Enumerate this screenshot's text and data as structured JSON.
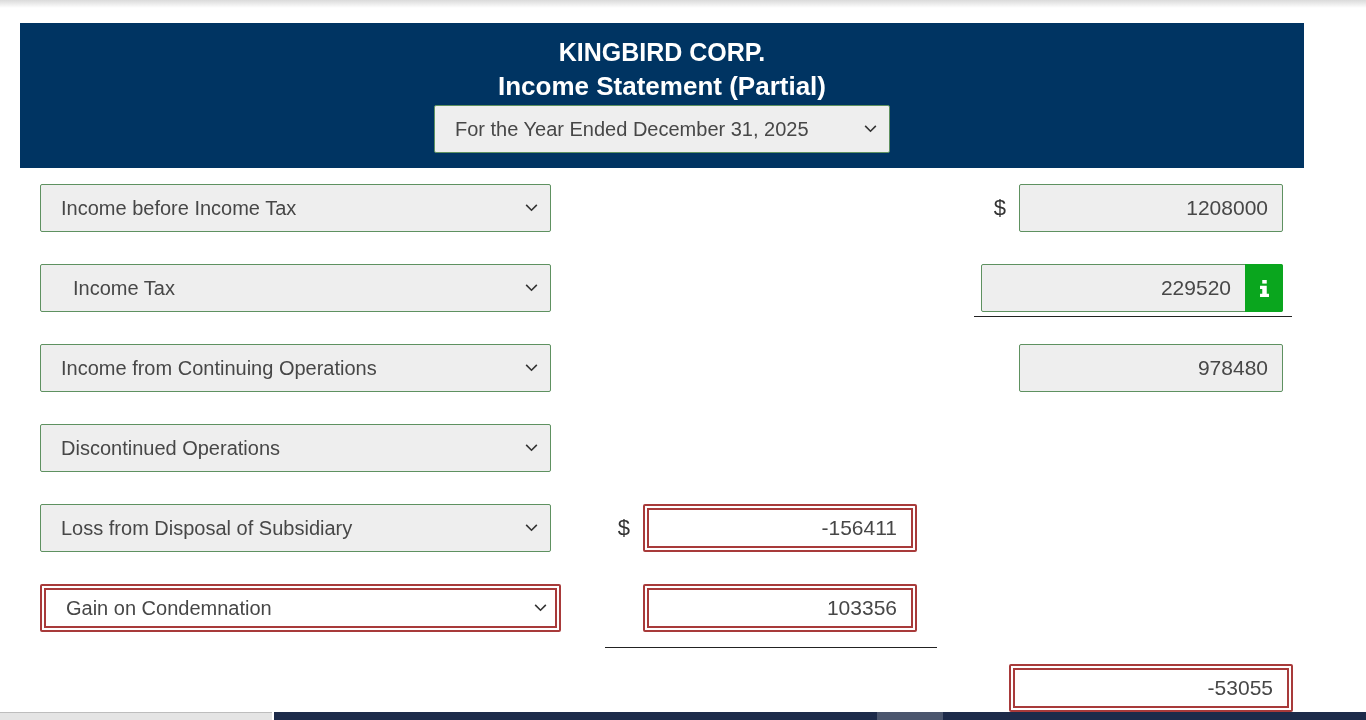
{
  "header": {
    "company": "KINGBIRD CORP.",
    "title": "Income Statement (Partial)",
    "period": {
      "value": "For the Year Ended December 31, 2025",
      "correct": true
    }
  },
  "lines": [
    {
      "label": {
        "value": "Income before Income Tax",
        "correct": true,
        "indented": false
      },
      "amounts": [
        {
          "kind": "outer",
          "currency": "$",
          "value": "1208000",
          "correct": true,
          "underline": false,
          "info_button": false
        }
      ]
    },
    {
      "label": {
        "value": "Income Tax",
        "correct": true,
        "indented": true
      },
      "amounts": [
        {
          "kind": "outer",
          "value": "229520",
          "correct": true,
          "underline": true,
          "info_button": true
        }
      ]
    },
    {
      "label": {
        "value": "Income from Continuing Operations",
        "correct": true,
        "indented": false
      },
      "amounts": [
        {
          "kind": "outer",
          "value": "978480",
          "correct": true,
          "underline": false,
          "info_button": false
        }
      ]
    },
    {
      "label": {
        "value": "Discontinued Operations",
        "correct": true,
        "indented": false
      }
    },
    {
      "label": {
        "value": "Loss from Disposal of Subsidiary",
        "correct": true,
        "indented": false
      },
      "amounts": [
        {
          "kind": "inner",
          "currency": "$",
          "value": "-156411",
          "correct": false,
          "underline": false,
          "info_button": false
        }
      ]
    },
    {
      "label": {
        "value": "Gain on Condemnation",
        "correct": false,
        "indented": false
      },
      "amounts": [
        {
          "kind": "inner",
          "value": "103356",
          "correct": false,
          "underline": true,
          "info_button": false
        }
      ]
    },
    {
      "amounts": [
        {
          "kind": "outer",
          "value": "-53055",
          "correct": false,
          "underline": false,
          "info_button": false
        }
      ]
    }
  ]
}
